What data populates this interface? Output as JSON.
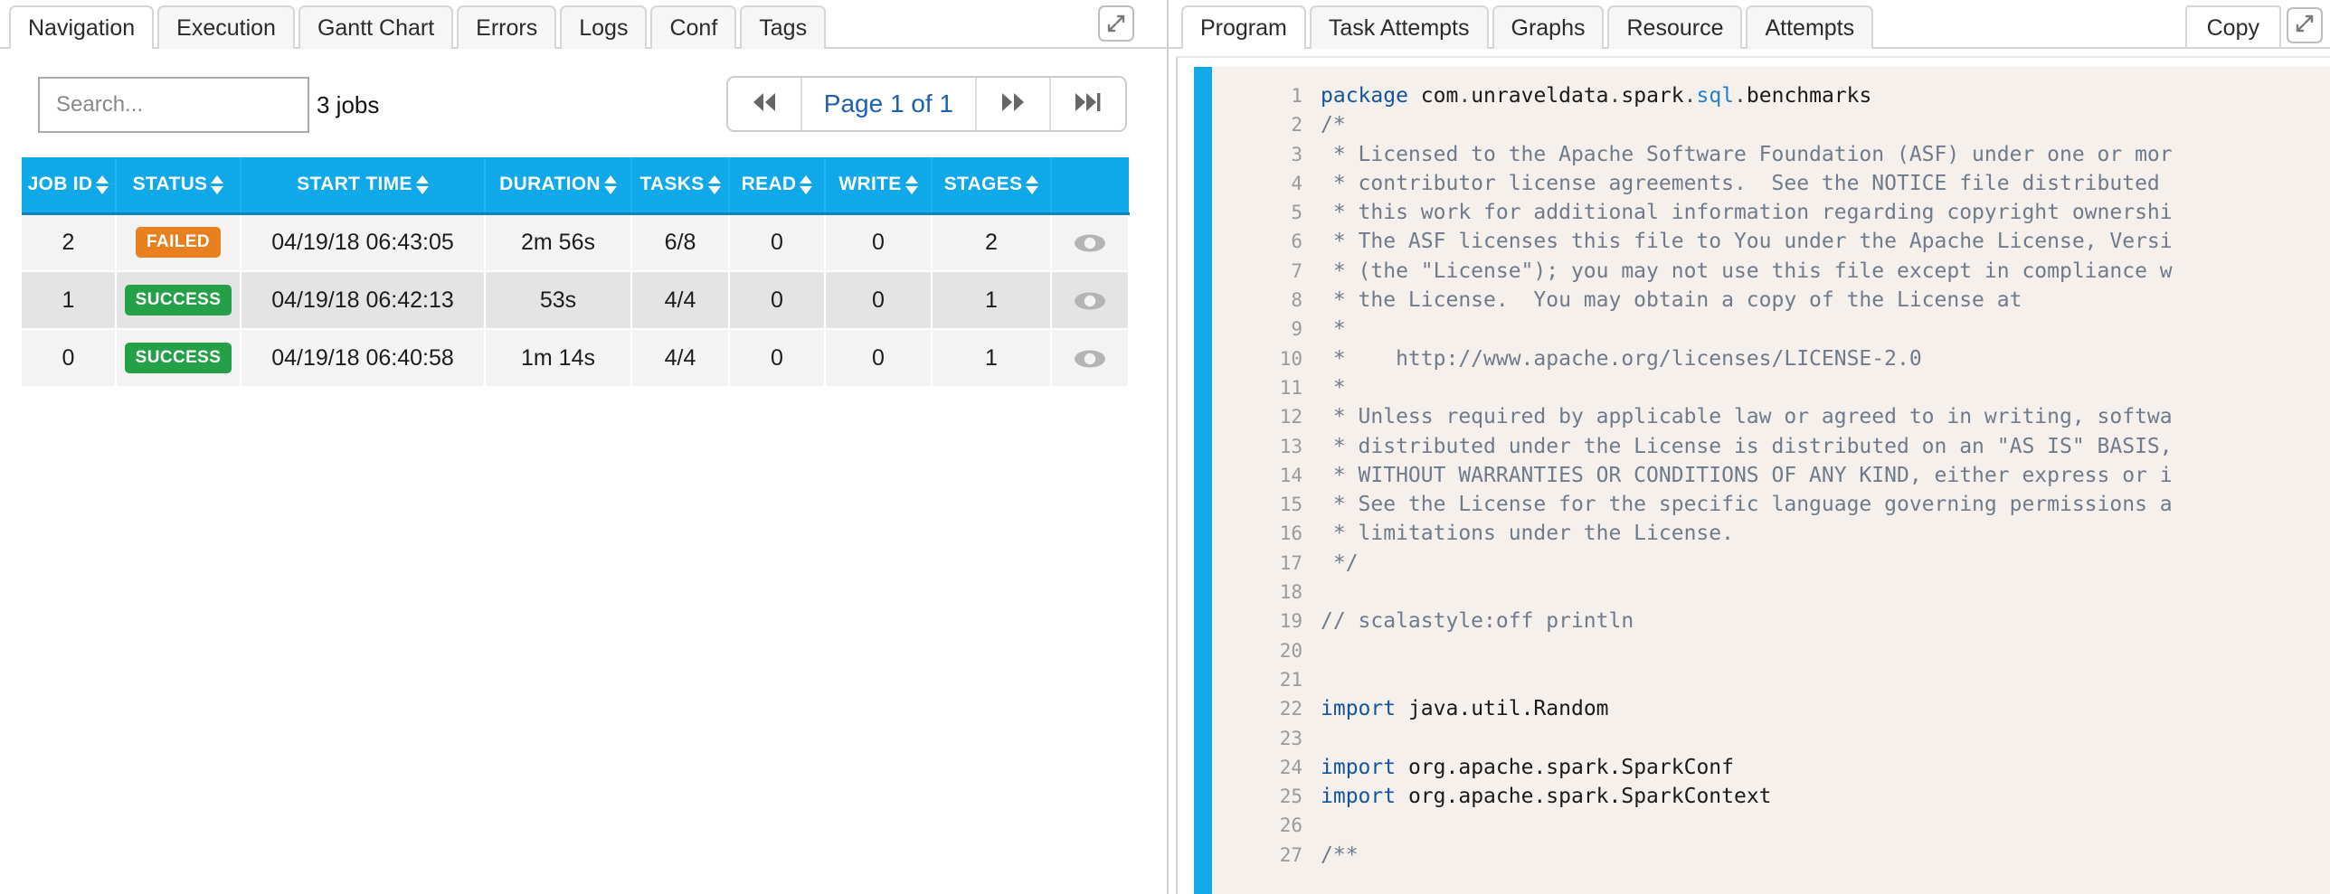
{
  "left_panel": {
    "tabs": [
      {
        "label": "Navigation",
        "active": true
      },
      {
        "label": "Execution",
        "active": false
      },
      {
        "label": "Gantt Chart",
        "active": false
      },
      {
        "label": "Errors",
        "active": false
      },
      {
        "label": "Logs",
        "active": false
      },
      {
        "label": "Conf",
        "active": false
      },
      {
        "label": "Tags",
        "active": false
      }
    ],
    "expand_icon": "expand-arrows-icon",
    "search": {
      "placeholder": "Search...",
      "value": ""
    },
    "jobs_count": "3 jobs",
    "pager": {
      "first_icon": "rewind-icon",
      "label": "Page 1 of 1",
      "next_icon": "fast-forward-icon",
      "last_icon": "skip-to-end-icon"
    },
    "table": {
      "columns": [
        {
          "label": "JOB ID",
          "sortable": true
        },
        {
          "label": "STATUS",
          "sortable": true
        },
        {
          "label": "START TIME",
          "sortable": true
        },
        {
          "label": "DURATION",
          "sortable": true
        },
        {
          "label": "TASKS",
          "sortable": true
        },
        {
          "label": "READ",
          "sortable": true
        },
        {
          "label": "WRITE",
          "sortable": true
        },
        {
          "label": "STAGES",
          "sortable": true
        },
        {
          "label": "",
          "sortable": false
        }
      ],
      "rows": [
        {
          "job_id": "2",
          "status": "FAILED",
          "status_kind": "failed",
          "start_time": "04/19/18 06:43:05",
          "duration": "2m 56s",
          "tasks": "6/8",
          "read": "0",
          "write": "0",
          "stages": "2",
          "action_icon": "eye-icon"
        },
        {
          "job_id": "1",
          "status": "SUCCESS",
          "status_kind": "success",
          "start_time": "04/19/18 06:42:13",
          "duration": "53s",
          "tasks": "4/4",
          "read": "0",
          "write": "0",
          "stages": "1",
          "action_icon": "eye-icon"
        },
        {
          "job_id": "0",
          "status": "SUCCESS",
          "status_kind": "success",
          "start_time": "04/19/18 06:40:58",
          "duration": "1m 14s",
          "tasks": "4/4",
          "read": "0",
          "write": "0",
          "stages": "1",
          "action_icon": "eye-icon"
        }
      ]
    }
  },
  "right_panel": {
    "tabs": [
      {
        "label": "Program",
        "active": true
      },
      {
        "label": "Task Attempts",
        "active": false
      },
      {
        "label": "Graphs",
        "active": false
      },
      {
        "label": "Resource",
        "active": false
      },
      {
        "label": "Attempts",
        "active": false
      }
    ],
    "copy_label": "Copy",
    "expand_icon": "expand-arrows-icon",
    "code": {
      "language": "scala",
      "lines": [
        {
          "n": "1",
          "text": "package com.unraveldata.spark.sql.benchmarks",
          "kind": "code"
        },
        {
          "n": "2",
          "text": "/*",
          "kind": "comment"
        },
        {
          "n": "3",
          "text": " * Licensed to the Apache Software Foundation (ASF) under one or mor",
          "kind": "comment"
        },
        {
          "n": "4",
          "text": " * contributor license agreements.  See the NOTICE file distributed",
          "kind": "comment"
        },
        {
          "n": "5",
          "text": " * this work for additional information regarding copyright ownershi",
          "kind": "comment"
        },
        {
          "n": "6",
          "text": " * The ASF licenses this file to You under the Apache License, Versi",
          "kind": "comment"
        },
        {
          "n": "7",
          "text": " * (the \"License\"); you may not use this file except in compliance w",
          "kind": "comment"
        },
        {
          "n": "8",
          "text": " * the License.  You may obtain a copy of the License at",
          "kind": "comment"
        },
        {
          "n": "9",
          "text": " *",
          "kind": "comment"
        },
        {
          "n": "10",
          "text": " *    http://www.apache.org/licenses/LICENSE-2.0",
          "kind": "comment"
        },
        {
          "n": "11",
          "text": " *",
          "kind": "comment"
        },
        {
          "n": "12",
          "text": " * Unless required by applicable law or agreed to in writing, softwa",
          "kind": "comment"
        },
        {
          "n": "13",
          "text": " * distributed under the License is distributed on an \"AS IS\" BASIS,",
          "kind": "comment"
        },
        {
          "n": "14",
          "text": " * WITHOUT WARRANTIES OR CONDITIONS OF ANY KIND, either express or i",
          "kind": "comment"
        },
        {
          "n": "15",
          "text": " * See the License for the specific language governing permissions a",
          "kind": "comment"
        },
        {
          "n": "16",
          "text": " * limitations under the License.",
          "kind": "comment"
        },
        {
          "n": "17",
          "text": " */",
          "kind": "comment"
        },
        {
          "n": "18",
          "text": "",
          "kind": "blank"
        },
        {
          "n": "19",
          "text": "// scalastyle:off println",
          "kind": "comment"
        },
        {
          "n": "20",
          "text": "",
          "kind": "blank"
        },
        {
          "n": "21",
          "text": "",
          "kind": "blank"
        },
        {
          "n": "22",
          "text": "import java.util.Random",
          "kind": "import"
        },
        {
          "n": "23",
          "text": "",
          "kind": "blank"
        },
        {
          "n": "24",
          "text": "import org.apache.spark.SparkConf",
          "kind": "import"
        },
        {
          "n": "25",
          "text": "import org.apache.spark.SparkContext",
          "kind": "import"
        },
        {
          "n": "26",
          "text": "",
          "kind": "blank"
        },
        {
          "n": "27",
          "text": "/**",
          "kind": "comment"
        }
      ]
    }
  },
  "colors": {
    "table_header": "#0fa8e8",
    "status_failed": "#e8801f",
    "status_success": "#24a148",
    "pager_link": "#1a5fb4",
    "code_accent": "#13a8e8",
    "code_background": "#f5f0ec"
  }
}
